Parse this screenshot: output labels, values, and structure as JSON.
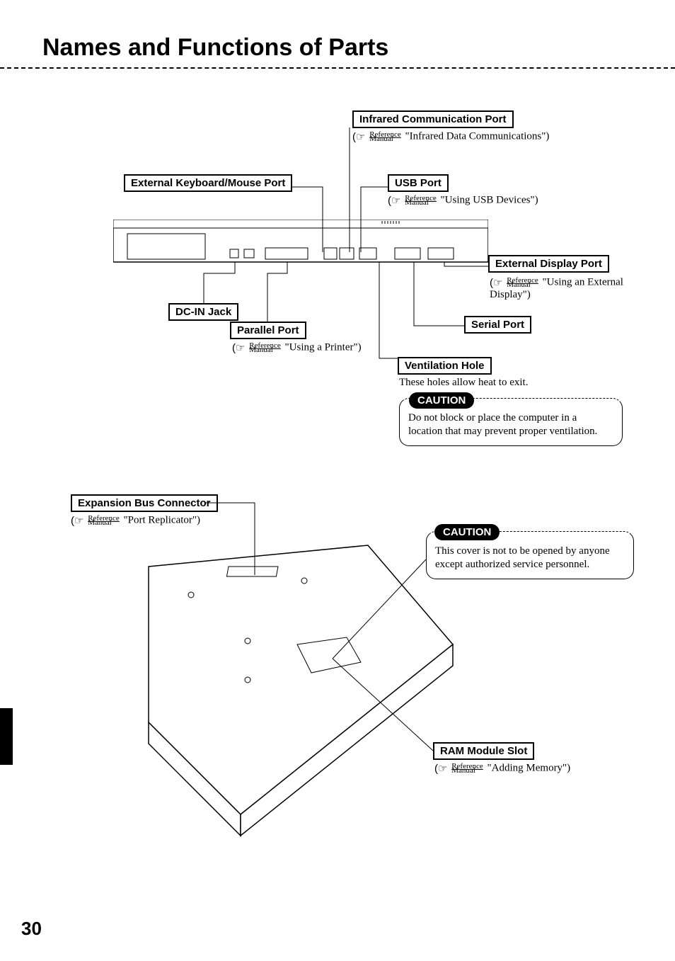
{
  "title": "Names and Functions of Parts",
  "page_number": "30",
  "ref_label_top": "Reference",
  "ref_label_bot": "Manual",
  "labels": {
    "infrared": "Infrared Communication Port",
    "infrared_ref": "\"Infrared Data Communications\")",
    "ext_kbd": "External Keyboard/Mouse Port",
    "usb": "USB Port",
    "usb_ref": "\"Using USB Devices\")",
    "ext_display": "External Display Port",
    "ext_display_ref": "\"Using an External Display\")",
    "dc_in": "DC-IN Jack",
    "parallel": "Parallel Port",
    "parallel_ref": "\"Using a Printer\")",
    "serial": "Serial Port",
    "vent": "Ventilation Hole",
    "vent_note": "These holes allow heat to exit.",
    "expansion": "Expansion Bus Connector",
    "expansion_ref": "\"Port Replicator\")",
    "ram": "RAM Module Slot",
    "ram_ref": "\"Adding Memory\")"
  },
  "caution_label": "CAUTION",
  "caution1_text": "Do not block or place the computer in a location that may prevent proper ventilation.",
  "caution2_text": "This cover is not to be opened by anyone except authorized service personnel."
}
